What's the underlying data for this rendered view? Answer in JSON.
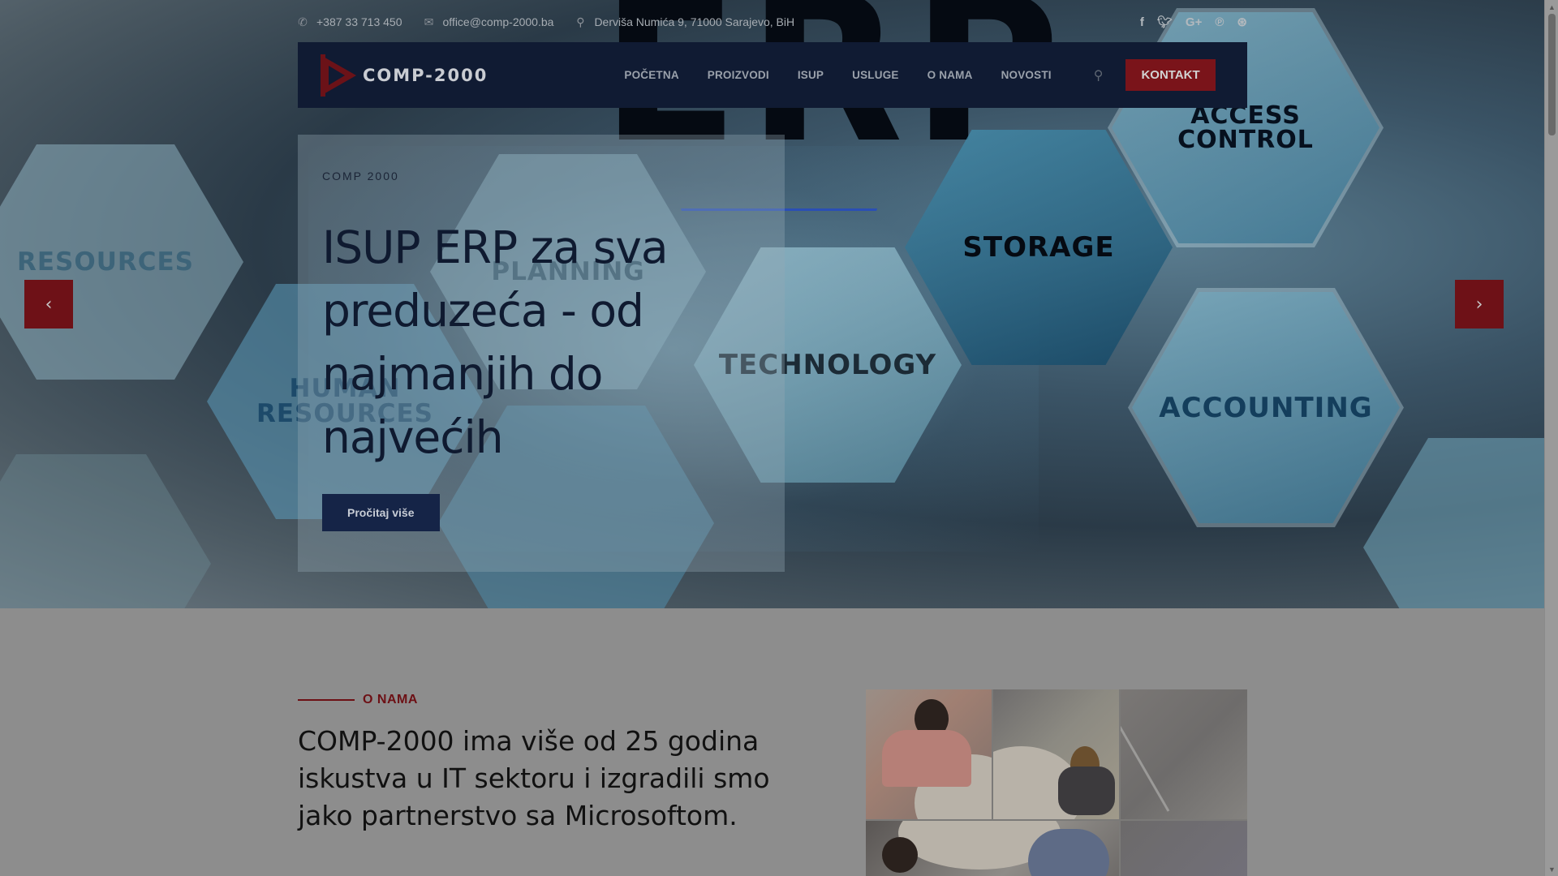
{
  "topbar": {
    "phone": "+387 33 713 450",
    "email": "office@comp-2000.ba",
    "address": "Derviša Numića 9, 71000 Sarajevo, BiH",
    "socials": [
      "facebook-icon",
      "twitter-icon",
      "google-plus-icon",
      "pinterest-icon",
      "dribbble-icon"
    ]
  },
  "header": {
    "logo_text": "COMP-2000",
    "nav": [
      "POČETNA",
      "PROIZVODI",
      "ISUP",
      "USLUGE",
      "O NAMA",
      "NOVOSTI"
    ],
    "cta": "KONTAKT"
  },
  "hero": {
    "background_words": {
      "erp": "ERP",
      "access": "ACCESS CONTROL",
      "storage": "STORAGE",
      "resources": "RESOURCES",
      "planning": "PLANNING",
      "human": "HUMAN RESOURCES",
      "technology": "TECHNOLOGY",
      "accounting": "ACCOUNTING"
    },
    "eyebrow": "COMP 2000",
    "title": "ISUP ERP za sva preduzeća - od najmanjih do najvećih",
    "button": "Pročitaj više",
    "prev": "‹",
    "next": "›"
  },
  "about": {
    "label": "O NAMA",
    "title": "COMP-2000 ima više od 25 godina iskustva u IT sektoru i izgradili smo jako partnerstvo sa Microsoftom."
  },
  "colors": {
    "brand_red": "#7a141a",
    "brand_navy": "#101b33"
  }
}
